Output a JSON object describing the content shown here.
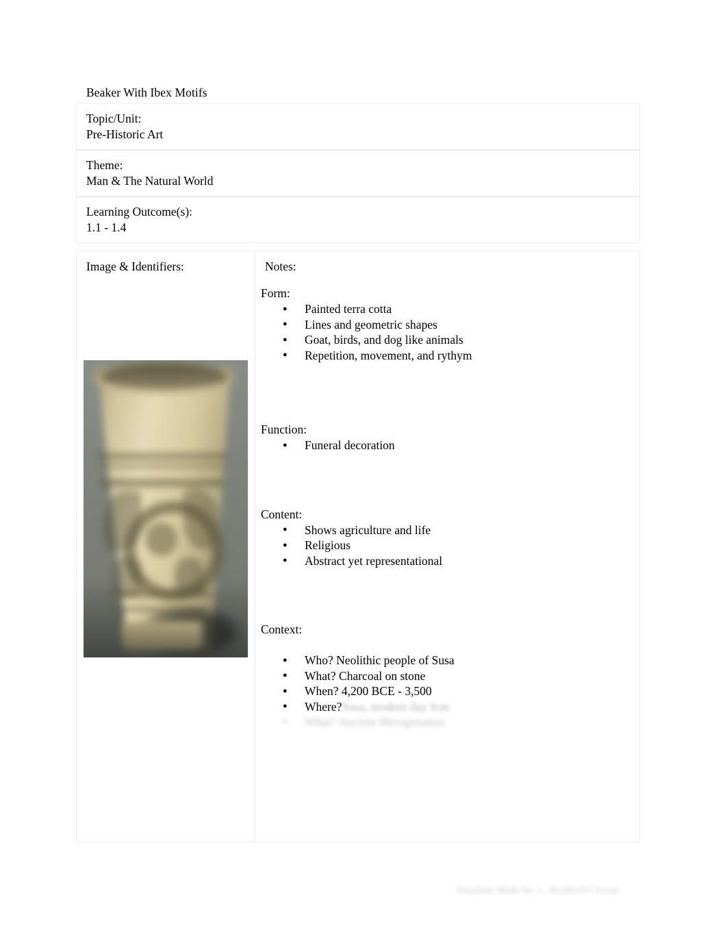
{
  "document": {
    "title": "Beaker With Ibex Motifs"
  },
  "meta_table": {
    "rows": [
      {
        "label": "Topic/Unit:",
        "value": "Pre-Historic Art"
      },
      {
        "label": "Theme:",
        "value": "Man & The Natural World"
      },
      {
        "label": "Learning Outcome(s):",
        "value": "1.1 - 1.4"
      }
    ]
  },
  "main_table": {
    "left_column": {
      "header": "Image & Identifiers:",
      "image": {
        "alt": "Beaker with ibex motifs, painted terra cotta vessel",
        "background_color": "#7d8279",
        "vessel_color": "#d8cfa8",
        "motif_color": "#5c553a"
      }
    },
    "right_column": {
      "header": "Notes:",
      "sections": [
        {
          "heading": "Form:",
          "items": [
            "Painted terra cotta",
            "Lines and geometric shapes",
            "Goat, birds, and dog like animals",
            "Repetition, movement, and rythym"
          ]
        },
        {
          "heading": "Function:",
          "items": [
            "Funeral decoration"
          ]
        },
        {
          "heading": "Content:",
          "items": [
            "Shows agriculture and life",
            "Religious",
            "Abstract yet representational"
          ]
        },
        {
          "heading": "Context:",
          "items": [
            "Who?   Neolithic people of Susa",
            "What?   Charcoal on stone",
            "When?   4,200 BCE - 3,500"
          ],
          "partial_items": [
            {
              "visible": "Where?",
              "illegible": "Susa, modern day Iran"
            }
          ],
          "illegible_items": [
            "What?  Ancient Mesopotamia"
          ]
        }
      ]
    }
  },
  "footer": {
    "text": "Template Made by: L. Bradford Croson"
  }
}
